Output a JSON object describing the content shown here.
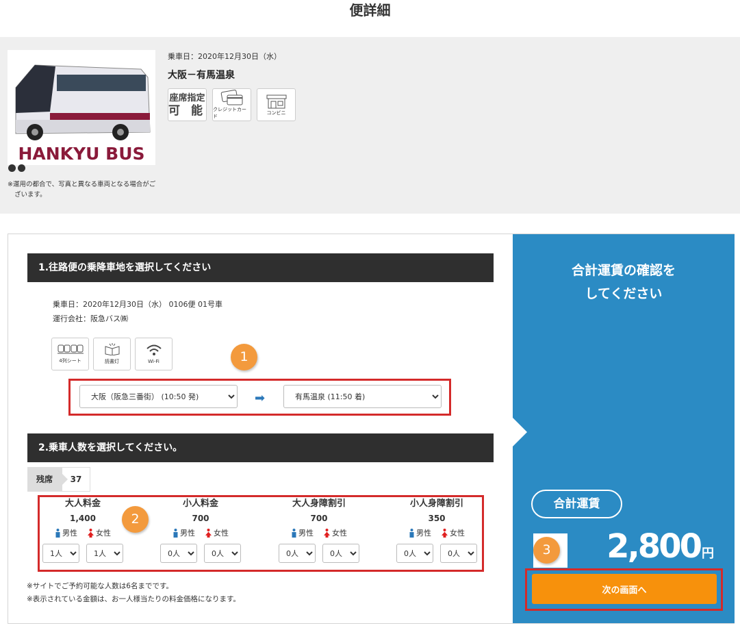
{
  "page_title": "便詳細",
  "summary": {
    "bus_logo_text": "HANKYU BUS",
    "photo_note": "※運用の都合で、写真と異なる車両となる場合がございます。",
    "ride_date": "乗車日：2020年12月30日（水）",
    "route": "大阪－有馬温泉",
    "features": [
      {
        "line1": "座席指定",
        "line2": "可 能",
        "icon": "seat-reservation-icon"
      },
      {
        "label": "クレジットカード",
        "icon": "credit-card-icon"
      },
      {
        "label": "コンビニ",
        "icon": "convenience-store-icon"
      }
    ]
  },
  "section1": {
    "title": "1.往路便の乗降車地を選択してください",
    "ride_info": "乗車日：2020年12月30日（水） 0106便 01号車",
    "operator": "運行会社：阪急バス㈱",
    "trip_features": [
      {
        "label": "4列シート",
        "icon": "four-row-seat-icon"
      },
      {
        "label": "読書灯",
        "icon": "reading-light-icon"
      },
      {
        "label": "Wi-Fi",
        "icon": "wifi-icon"
      }
    ],
    "callout": "1",
    "from_stop": "大阪（阪急三番街） (10:50 発)",
    "to_stop": "有馬温泉 (11:50 着)"
  },
  "section2": {
    "title": "2.乗車人数を選択してください。",
    "remaining_label": "残席",
    "remaining_count": "37",
    "callout": "2",
    "male_label": "男性",
    "female_label": "女性",
    "fares": [
      {
        "name": "大人料金",
        "price": "1,400",
        "male": "1人",
        "female": "1人"
      },
      {
        "name": "小人料金",
        "price": "700",
        "male": "0人",
        "female": "0人"
      },
      {
        "name": "大人身障割引",
        "price": "700",
        "male": "0人",
        "female": "0人"
      },
      {
        "name": "小人身障割引",
        "price": "350",
        "male": "0人",
        "female": "0人"
      }
    ],
    "note1": "※サイトでご予約可能な人数は6名までです。",
    "note2": "※表示されている金額は、お一人様当たりの料金価格になります。"
  },
  "total": {
    "message_line1": "合計運賃の確認を",
    "message_line2": "してください",
    "label": "合計運賃",
    "amount": "2,800",
    "currency": "円",
    "callout": "3",
    "next_button": "次の画面へ"
  },
  "colors": {
    "panel_blue": "#2b8bc4",
    "button_orange": "#f7910c",
    "callout_orange": "#f39a3d",
    "highlight_red": "#d42a2a",
    "male_blue": "#2b78b9",
    "female_red": "#e02020",
    "section_bar": "#2f2f2f"
  }
}
